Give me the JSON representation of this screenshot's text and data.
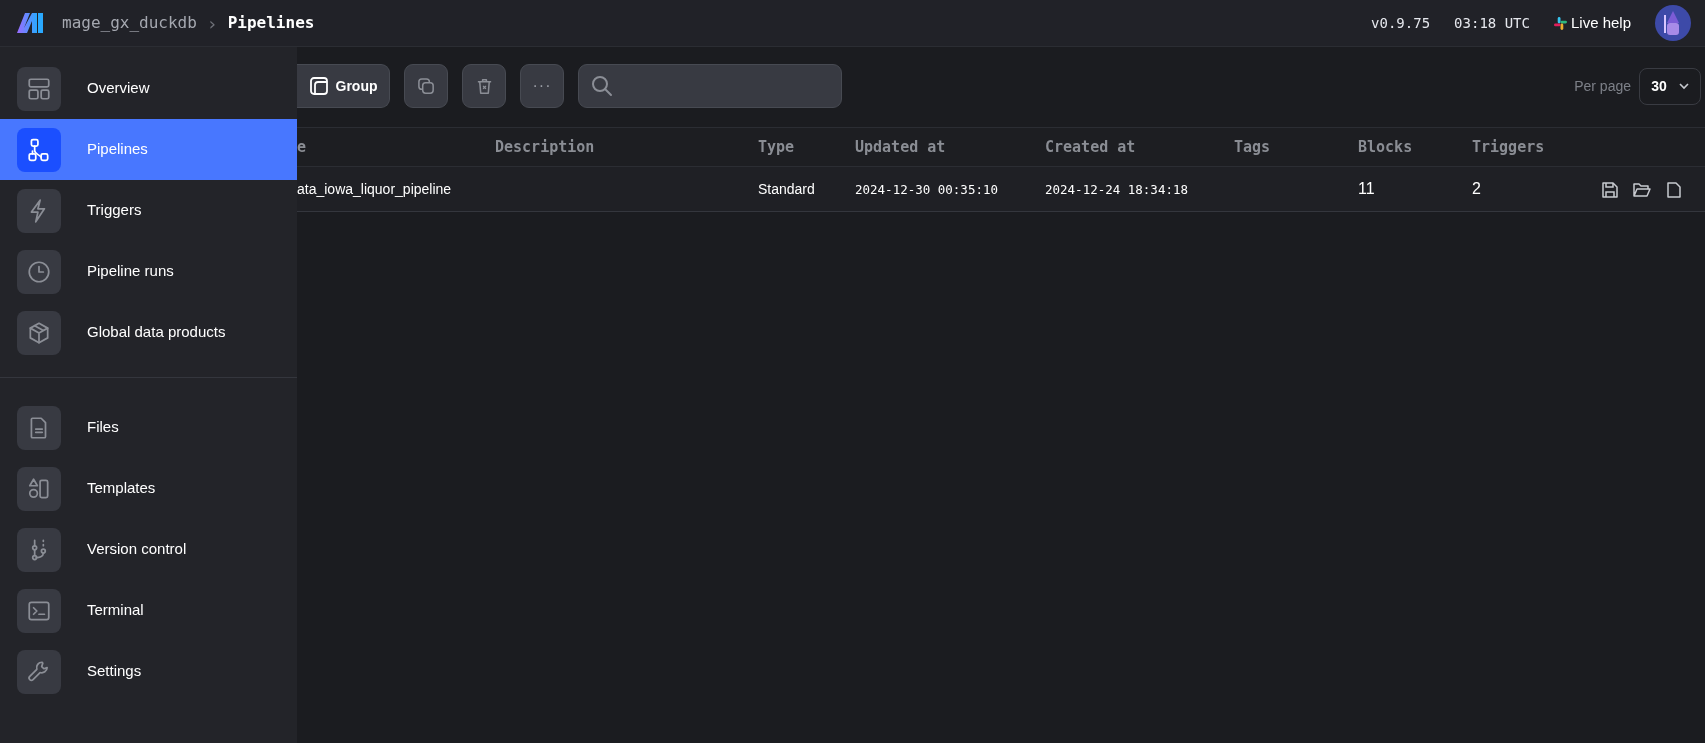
{
  "header": {
    "project": "mage_gx_duckdb",
    "separator": "›",
    "page": "Pipelines",
    "version": "v0.9.75",
    "time": "03:18 UTC",
    "help": "Live help"
  },
  "sidebar": {
    "groups": [
      {
        "items": [
          {
            "label": "Overview",
            "selected": false
          },
          {
            "label": "Pipelines",
            "selected": true
          },
          {
            "label": "Triggers",
            "selected": false
          },
          {
            "label": "Pipeline runs",
            "selected": false
          },
          {
            "label": "Global data products",
            "selected": false
          }
        ]
      },
      {
        "items": [
          {
            "label": "Files",
            "selected": false
          },
          {
            "label": "Templates",
            "selected": false
          },
          {
            "label": "Version control",
            "selected": false
          },
          {
            "label": "Terminal",
            "selected": false
          },
          {
            "label": "Settings",
            "selected": false
          }
        ]
      }
    ]
  },
  "toolbar": {
    "buttons": [
      {
        "kind": "group",
        "label": "Group"
      },
      {
        "kind": "clone"
      },
      {
        "kind": "delete"
      },
      {
        "kind": "more",
        "label": "···"
      }
    ]
  },
  "per_page": {
    "label": "Per page",
    "value": "30"
  },
  "table": {
    "columns": [
      "e",
      "Description",
      "Type",
      "Updated at",
      "Created at",
      "Tags",
      "Blocks",
      "Triggers"
    ],
    "rows": [
      {
        "name": "ata_iowa_liquor_pipeline",
        "type": "Standard",
        "updated_at": "2024-12-30 00:35:10",
        "created_at": "2024-12-24 18:34:18",
        "blocks": "11",
        "triggers": "2"
      }
    ]
  }
}
